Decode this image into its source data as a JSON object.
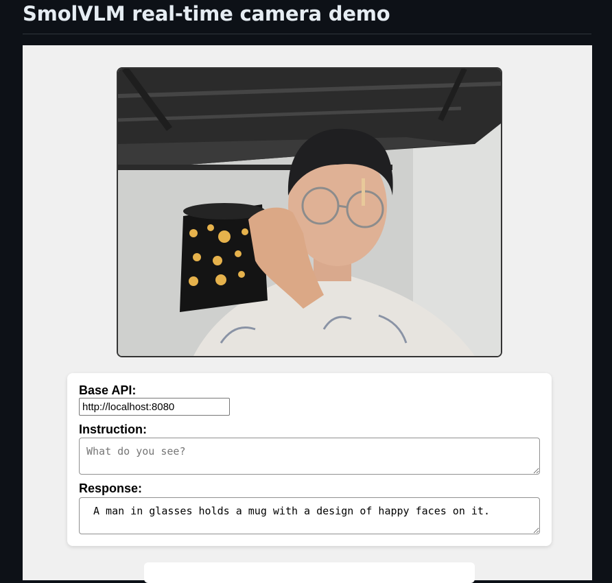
{
  "page": {
    "title": "SmolVLM real-time camera demo"
  },
  "camera": {
    "icon": "camera-feed"
  },
  "form": {
    "base_api_label": "Base API:",
    "base_api_value": "http://localhost:8080",
    "instruction_label": "Instruction:",
    "instruction_placeholder": "What do you see?",
    "response_label": "Response:",
    "response_value": "A man in glasses holds a mug with a design of happy faces on it."
  },
  "colors": {
    "page_background": "#0d1117",
    "title_text": "#e6edf3",
    "frame_background": "#f0f0f0",
    "card_background": "#ffffff"
  }
}
